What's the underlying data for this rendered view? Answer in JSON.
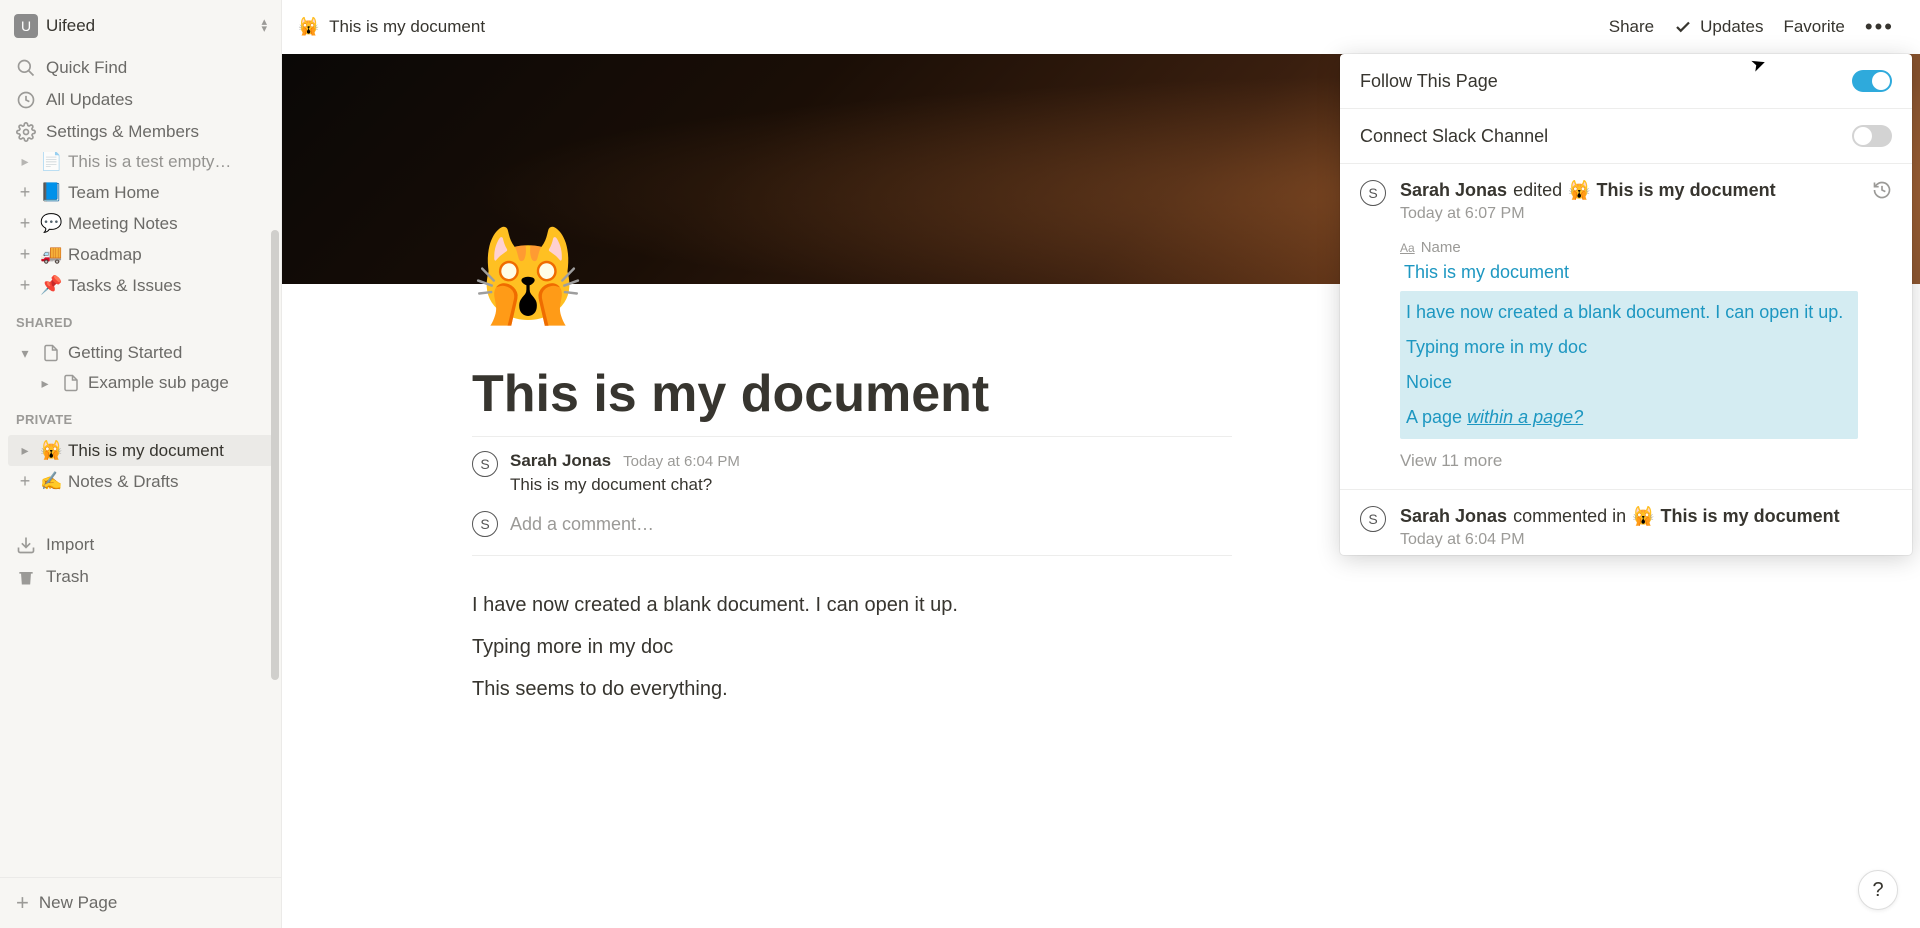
{
  "workspace": {
    "initial": "U",
    "name": "Uifeed"
  },
  "quick_nav": {
    "find": "Quick Find",
    "updates": "All Updates",
    "settings": "Settings & Members"
  },
  "pages_top": [
    {
      "emoji": "📄",
      "label": "This is a test empty…"
    },
    {
      "emoji": "📘",
      "label": "Team Home"
    },
    {
      "emoji": "💬",
      "label": "Meeting Notes"
    },
    {
      "emoji": "🚚",
      "label": "Roadmap"
    },
    {
      "emoji": "📌",
      "label": "Tasks & Issues"
    }
  ],
  "shared": {
    "label": "SHARED",
    "items": [
      {
        "label": "Getting Started",
        "icon": "page"
      },
      {
        "label": "Example sub page",
        "icon": "page",
        "sub": true
      }
    ]
  },
  "private": {
    "label": "PRIVATE",
    "items": [
      {
        "emoji": "🙀",
        "label": "This is my document",
        "active": true
      },
      {
        "emoji": "✍️",
        "label": "Notes & Drafts"
      }
    ]
  },
  "footer": {
    "import": "Import",
    "trash": "Trash",
    "new_page": "New Page"
  },
  "topbar": {
    "emoji": "🙀",
    "title": "This is my document",
    "share": "Share",
    "updates": "Updates",
    "favorite": "Favorite"
  },
  "page": {
    "emoji": "🙀",
    "title": "This is my document",
    "comment": {
      "avatar": "S",
      "author": "Sarah Jonas",
      "time": "Today at 6:04 PM",
      "text": "This is my document chat?"
    },
    "add_comment_placeholder": "Add a comment…",
    "body": [
      "I have now created a blank document. I can open it up.",
      "Typing more in my doc",
      "This seems to do everything."
    ]
  },
  "updates_panel": {
    "follow": {
      "label": "Follow This Page",
      "on": true
    },
    "slack": {
      "label": "Connect Slack Channel",
      "on": false
    },
    "entries": [
      {
        "avatar": "S",
        "user": "Sarah Jonas",
        "action": "edited",
        "emoji": "🙀",
        "doc": "This is my document",
        "time": "Today at 6:07 PM",
        "name_label": "Name",
        "name_value": "This is my document",
        "highlighted": [
          "I have now created a blank document. I can open it up.",
          "Typing more in my doc",
          "Noice"
        ],
        "highlighted_link_prefix": "A page ",
        "highlighted_link_italic": "within a page?",
        "view_more": "View 11 more"
      },
      {
        "avatar": "S",
        "user": "Sarah Jonas",
        "action": "commented in",
        "emoji": "🙀",
        "doc": "This is my document",
        "time": "Today at 6:04 PM"
      }
    ]
  },
  "help": "?"
}
